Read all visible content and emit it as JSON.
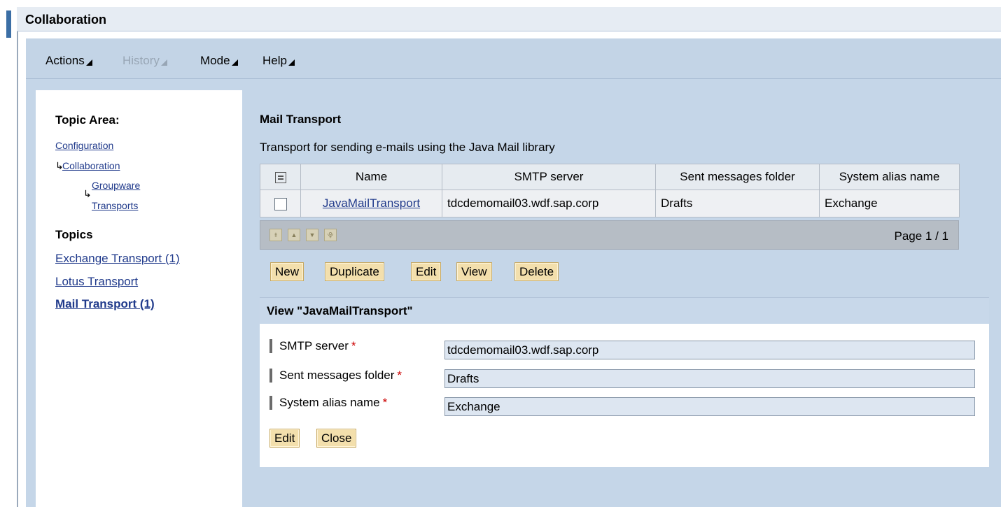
{
  "window": {
    "title": "Collaboration"
  },
  "menu": [
    {
      "label": "Actions",
      "enabled": true
    },
    {
      "label": "History",
      "enabled": false
    },
    {
      "label": "Mode",
      "enabled": true
    },
    {
      "label": "Help",
      "enabled": true
    }
  ],
  "nav": {
    "topic_area_heading": "Topic Area:",
    "path": [
      "Configuration",
      "Collaboration",
      "Groupware",
      "Transports"
    ],
    "topics_heading": "Topics",
    "topics": [
      {
        "label": "Exchange Transport (1)",
        "active": false
      },
      {
        "label": "Lotus Transport",
        "active": false
      },
      {
        "label": "Mail Transport (1)",
        "active": true
      }
    ]
  },
  "section": {
    "title": "Mail Transport",
    "description": "Transport for sending e-mails using the Java Mail library"
  },
  "table": {
    "columns": [
      "Name",
      "SMTP server",
      "Sent messages folder",
      "System alias name"
    ],
    "rows": [
      {
        "name": "JavaMailTransport",
        "smtp": "tdcdemomail03.wdf.sap.corp",
        "folder": "Drafts",
        "alias": "Exchange"
      }
    ],
    "pager": "Page 1 / 1"
  },
  "actions": [
    "New",
    "Duplicate",
    "Edit",
    "View",
    "Delete"
  ],
  "detail": {
    "title": "View \"JavaMailTransport\"",
    "fields": [
      {
        "label": "SMTP server",
        "value": "tdcdemomail03.wdf.sap.corp",
        "required": "*"
      },
      {
        "label": "Sent messages folder",
        "value": "Drafts",
        "required": "*"
      },
      {
        "label": "System alias name",
        "value": "Exchange",
        "required": "*"
      }
    ],
    "buttons": [
      "Edit",
      "Close"
    ]
  },
  "colors": {
    "link": "#203a8b",
    "button": "#f3dfac",
    "panel": "#c5d6e8",
    "accent": "#3b6ea5"
  }
}
